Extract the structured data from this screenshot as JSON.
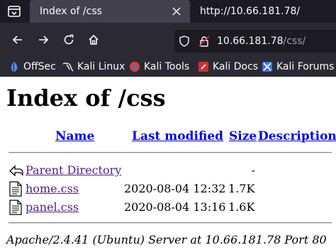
{
  "browser": {
    "tabs": [
      {
        "title": "Index of /css",
        "active": true
      },
      {
        "title": "http://10.66.181.78/",
        "active": false
      }
    ],
    "url": {
      "host": "10.66.181.78",
      "path": "/css/"
    },
    "bookmarks": [
      {
        "label": "OffSec",
        "icon": "offsec-icon"
      },
      {
        "label": "Kali Linux",
        "icon": "kali-dragon-icon"
      },
      {
        "label": "Kali Tools",
        "icon": "kali-tools-icon"
      },
      {
        "label": "Kali Docs",
        "icon": "kali-docs-icon"
      },
      {
        "label": "Kali Forums",
        "icon": "kali-forums-icon"
      }
    ]
  },
  "listing": {
    "title": "Index of /css",
    "columns": {
      "name": "Name",
      "modified": "Last modified",
      "size": "Size",
      "description": "Description"
    },
    "parent": {
      "name": "Parent Directory",
      "modified": "",
      "size": "-"
    },
    "rows": [
      {
        "name": "home.css",
        "modified": "2020-08-04 12:32",
        "size": "1.7K"
      },
      {
        "name": "panel.css",
        "modified": "2020-08-04 13:16",
        "size": "1.6K"
      }
    ],
    "address": "Apache/2.4.41 (Ubuntu) Server at 10.66.181.78 Port 80"
  },
  "colors": {
    "link": "#0000ee",
    "visited": "#551a8b",
    "chrome_dark": "#1c1b22",
    "chrome": "#2b2a33"
  }
}
